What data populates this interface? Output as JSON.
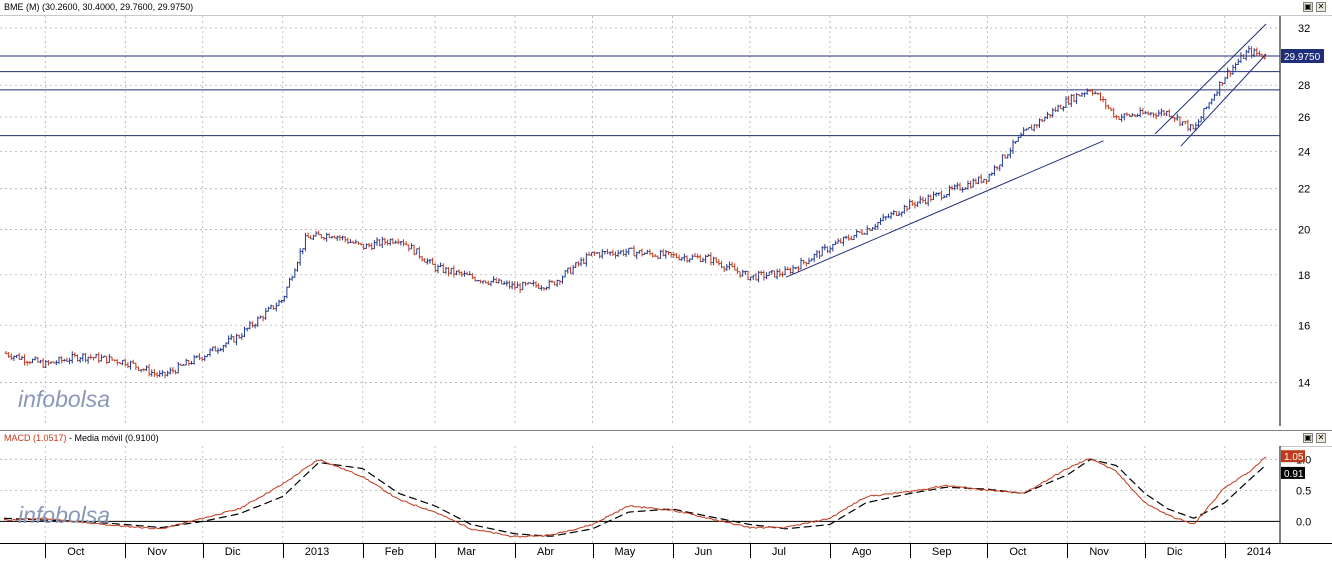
{
  "price_panel": {
    "title": "BME (M) (30.2600, 30.4000, 29.7600, 29.9750)",
    "last_price_tag": "29.9750",
    "watermark": "infobolsa",
    "y_ticks": [
      "14",
      "16",
      "18",
      "20",
      "22",
      "24",
      "26",
      "28",
      "32"
    ]
  },
  "macd_panel": {
    "title_macd": "MACD (1.0517)",
    "title_sep": " - ",
    "title_ma": "Media móvil (0.9100)",
    "macd_tag": "1.05",
    "ma_tag": "0.91",
    "watermark": "infobolsa",
    "y_ticks": [
      "1.0",
      "0.5",
      "0.0"
    ]
  },
  "x_axis": {
    "labels": [
      "Oct",
      "Nov",
      "Dic",
      "2013",
      "Feb",
      "Mar",
      "Abr",
      "May",
      "Jun",
      "Jul",
      "Ago",
      "Sep",
      "Oct",
      "Nov",
      "Dic",
      "2014"
    ]
  },
  "window_buttons": {
    "restore": "▣",
    "close": "✕"
  },
  "colors": {
    "bar_up": "#1f3a93",
    "bar_down": "#c0391b",
    "macd": "#c0391b",
    "signal": "#000000",
    "trendline": "#1f2e7a",
    "grid": "#b0b0b0"
  },
  "chart_data": [
    {
      "type": "bar",
      "subtype": "ohlc",
      "title": "BME (M)",
      "last": {
        "open": 30.26,
        "high": 30.4,
        "low": 29.76,
        "close": 29.975
      },
      "x": [
        "2012-09-15",
        "2012-10-01",
        "2012-10-15",
        "2012-11-01",
        "2012-11-15",
        "2012-12-01",
        "2012-12-15",
        "2013-01-01",
        "2013-01-10",
        "2013-01-20",
        "2013-02-01",
        "2013-02-15",
        "2013-03-01",
        "2013-03-15",
        "2013-04-01",
        "2013-04-15",
        "2013-05-01",
        "2013-05-15",
        "2013-06-01",
        "2013-06-15",
        "2013-07-01",
        "2013-07-15",
        "2013-08-01",
        "2013-08-15",
        "2013-09-01",
        "2013-09-15",
        "2013-10-01",
        "2013-10-15",
        "2013-11-01",
        "2013-11-10",
        "2013-11-20",
        "2013-12-01",
        "2013-12-10",
        "2013-12-20",
        "2014-01-01",
        "2014-01-10",
        "2014-01-17"
      ],
      "close": [
        15.0,
        14.6,
        14.9,
        14.7,
        14.2,
        14.9,
        15.6,
        17.0,
        19.6,
        19.8,
        19.2,
        19.6,
        18.3,
        17.9,
        17.5,
        17.6,
        18.9,
        19.0,
        18.8,
        18.7,
        17.9,
        18.1,
        19.2,
        20.0,
        21.2,
        21.8,
        22.6,
        25.0,
        27.0,
        27.8,
        26.0,
        26.2,
        26.3,
        25.2,
        28.6,
        30.3,
        29.975
      ],
      "horizontal_lines": [
        24.9,
        27.7,
        28.9,
        29.975
      ],
      "trendlines": [
        {
          "from": [
            "2013-07-15",
            17.9
          ],
          "to": [
            "2013-11-15",
            24.6
          ]
        },
        {
          "from": [
            "2013-12-15",
            24.3
          ],
          "to": [
            "2014-01-17",
            30.1
          ]
        },
        {
          "from": [
            "2013-12-05",
            25.0
          ],
          "to": [
            "2014-01-17",
            32.3
          ]
        }
      ],
      "ylim": [
        12.8,
        32.6
      ],
      "y_ticks": [
        14,
        16,
        18,
        20,
        22,
        24,
        26,
        28,
        32
      ],
      "grid": true,
      "logscale": true
    },
    {
      "type": "line",
      "x": [
        "2012-09-15",
        "2012-10-01",
        "2012-10-15",
        "2012-11-01",
        "2012-11-15",
        "2012-12-01",
        "2012-12-15",
        "2013-01-01",
        "2013-01-15",
        "2013-02-01",
        "2013-02-15",
        "2013-03-01",
        "2013-03-15",
        "2013-04-01",
        "2013-04-15",
        "2013-05-01",
        "2013-05-15",
        "2013-06-01",
        "2013-06-15",
        "2013-07-01",
        "2013-07-15",
        "2013-08-01",
        "2013-08-15",
        "2013-09-01",
        "2013-09-15",
        "2013-10-01",
        "2013-10-15",
        "2013-11-01",
        "2013-11-10",
        "2013-11-20",
        "2013-12-01",
        "2013-12-10",
        "2013-12-20",
        "2014-01-01",
        "2014-01-10",
        "2014-01-17"
      ],
      "series": [
        {
          "name": "MACD",
          "values": [
            0.02,
            0.05,
            -0.02,
            -0.08,
            -0.12,
            0.05,
            0.2,
            0.6,
            1.0,
            0.72,
            0.35,
            0.15,
            -0.12,
            -0.25,
            -0.22,
            -0.05,
            0.25,
            0.18,
            0.05,
            -0.1,
            -0.1,
            0.05,
            0.4,
            0.48,
            0.58,
            0.5,
            0.45,
            0.85,
            1.02,
            0.8,
            0.3,
            0.1,
            -0.05,
            0.55,
            0.78,
            1.05
          ]
        },
        {
          "name": "Media móvil",
          "values": [
            0.05,
            0.02,
            0.0,
            -0.05,
            -0.1,
            0.0,
            0.12,
            0.4,
            0.95,
            0.85,
            0.45,
            0.25,
            -0.05,
            -0.2,
            -0.24,
            -0.12,
            0.15,
            0.2,
            0.08,
            -0.05,
            -0.12,
            -0.05,
            0.3,
            0.45,
            0.55,
            0.52,
            0.45,
            0.75,
            1.0,
            0.9,
            0.45,
            0.2,
            0.05,
            0.3,
            0.65,
            0.91
          ]
        }
      ],
      "ylim": [
        -0.3,
        1.15
      ],
      "y_ticks": [
        0.0,
        0.5,
        1.0
      ],
      "zero_line": true,
      "grid": true
    }
  ]
}
